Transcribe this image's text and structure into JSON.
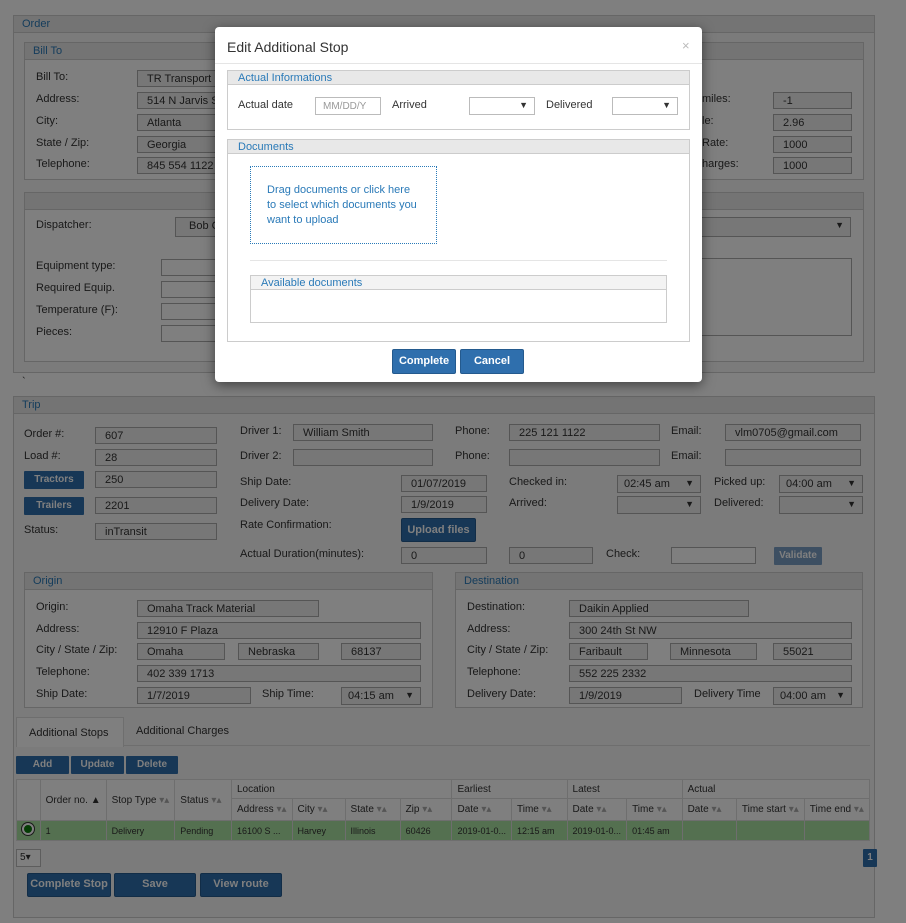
{
  "order": {
    "header": "Order",
    "billto": {
      "header": "Bill To",
      "rows": [
        {
          "label": "Bill To:",
          "value": "TR Transport"
        },
        {
          "label": "Address:",
          "value": "514 N Jarvis S"
        },
        {
          "label": "City:",
          "value": "Atlanta"
        },
        {
          "label": "State / Zip:",
          "value": "Georgia"
        },
        {
          "label": "Telephone:",
          "value": "845 554 1122"
        }
      ],
      "right_rows": [
        {
          "label": "miles:",
          "value": "-1"
        },
        {
          "label": "le:",
          "value": "2.96"
        },
        {
          "label": "Rate:",
          "value": "1000"
        },
        {
          "label": "harges:",
          "value": "1000"
        }
      ]
    },
    "dispatcher": {
      "label": "Dispatcher:",
      "value": "Bob C"
    },
    "equipment": [
      "Equipment type:",
      "Required Equip.",
      "Temperature (F):",
      "Pieces:"
    ]
  },
  "trip": {
    "header": "Trip",
    "order_no": {
      "label": "Order #:",
      "value": "607"
    },
    "load_no": {
      "label": "Load #:",
      "value": "28"
    },
    "tractors": {
      "label": "Tractors",
      "value": "250"
    },
    "trailers": {
      "label": "Trailers",
      "value": "2201"
    },
    "status": {
      "label": "Status:",
      "value": "inTransit"
    },
    "driver1": {
      "label": "Driver 1:",
      "value": "William Smith"
    },
    "driver2": {
      "label": "Driver 2:",
      "value": ""
    },
    "phone1": {
      "label": "Phone:",
      "value": "225 121 1122"
    },
    "phone2": {
      "label": "Phone:",
      "value": ""
    },
    "email1": {
      "label": "Email:",
      "value": "vlm0705@gmail.com"
    },
    "email2": {
      "label": "Email:",
      "value": ""
    },
    "ship_date": {
      "label": "Ship Date:",
      "value": "01/07/2019"
    },
    "delivery_date": {
      "label": "Delivery Date:",
      "value": "1/9/2019"
    },
    "rate_conf": {
      "label": "Rate Confirmation:",
      "button": "Upload files"
    },
    "checked_in": {
      "label": "Checked in:",
      "value": "02:45 am"
    },
    "arrived": {
      "label": "Arrived:",
      "value": ""
    },
    "picked_up": {
      "label": "Picked up:",
      "value": "04:00 am"
    },
    "delivered": {
      "label": "Delivered:",
      "value": ""
    },
    "actual_duration": {
      "label": "Actual Duration(minutes):",
      "value1": "0",
      "value2": "0"
    },
    "check": {
      "label": "Check:",
      "value": "",
      "button": "Validate"
    }
  },
  "origin": {
    "header": "Origin",
    "origin": {
      "label": "Origin:",
      "value": "Omaha Track Material"
    },
    "address": {
      "label": "Address:",
      "value": "12910 F Plaza"
    },
    "csz": {
      "label": "City / State / Zip:",
      "city": "Omaha",
      "state": "Nebraska",
      "zip": "68137"
    },
    "telephone": {
      "label": "Telephone:",
      "value": "402 339 1713"
    },
    "ship_date": {
      "label": "Ship Date:",
      "value": "1/7/2019"
    },
    "ship_time": {
      "label": "Ship Time:",
      "value": "04:15 am"
    }
  },
  "destination": {
    "header": "Destination",
    "destination": {
      "label": "Destination:",
      "value": "Daikin Applied"
    },
    "address": {
      "label": "Address:",
      "value": "300 24th St NW"
    },
    "csz": {
      "label": "City / State / Zip:",
      "city": "Faribault",
      "state": "Minnesota",
      "zip": "55021"
    },
    "telephone": {
      "label": "Telephone:",
      "value": "552 225 2332"
    },
    "delivery_date": {
      "label": "Delivery Date:",
      "value": "1/9/2019"
    },
    "delivery_time": {
      "label": "Delivery Time",
      "value": "04:00 am"
    }
  },
  "tabs": [
    "Additional Stops",
    "Additional Charges"
  ],
  "stop_actions": [
    "Add",
    "Update",
    "Delete"
  ],
  "stops_table": {
    "group_headers": {
      "location": "Location",
      "earliest": "Earliest",
      "latest": "Latest",
      "actual": "Actual"
    },
    "columns": [
      "Order no.",
      "Stop Type",
      "Status",
      "Address",
      "City",
      "State",
      "Zip",
      "Date",
      "Time",
      "Date",
      "Time",
      "Date",
      "Time start",
      "Time end"
    ],
    "rows": [
      [
        "1",
        "Delivery",
        "Pending",
        "16100 S ...",
        "Harvey",
        "Illinois",
        "60426",
        "2019-01-0...",
        "12:15 am",
        "2019-01-0...",
        "01:45 am",
        "",
        "",
        ""
      ]
    ]
  },
  "pager": {
    "page_size": "5",
    "current_page": "1"
  },
  "bottom_buttons": [
    "Complete Stop",
    "Save",
    "View route"
  ],
  "misc_dot": "`",
  "modal": {
    "title": "Edit Additional Stop",
    "close": "×",
    "actual_section": "Actual Informations",
    "actual_date_label": "Actual date",
    "actual_date_placeholder": "MM/DD/Y",
    "arrived_label": "Arrived",
    "delivered_label": "Delivered",
    "documents_section": "Documents",
    "dropzone_text": "Drag documents or click here to select which documents you want to upload",
    "available_documents": "Available documents",
    "complete_button": "Complete",
    "cancel_button": "Cancel"
  },
  "colors": {
    "accent": "#2f6fad",
    "header_text": "#2a7ab8",
    "row_highlight": "#a9e0a0"
  }
}
